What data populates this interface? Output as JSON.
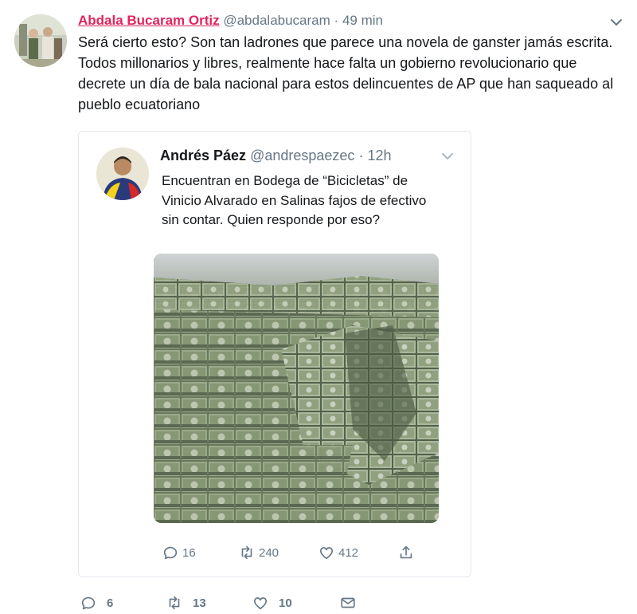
{
  "tweet": {
    "display_name": "Abdala Bucaram Ortiz",
    "handle": "@abdalabucaram",
    "separator": "·",
    "time": "49 min",
    "text": "Será cierto esto? Son tan ladrones que parece una novela de ganster jamás escrita. Todos millonarios y libres, realmente hace falta un gobierno revolucionario que decrete un día de bala nacional para estos delincuentes de AP que han saqueado al pueblo ecuatoriano",
    "actions": {
      "reply_count": "6",
      "retweet_count": "13",
      "like_count": "10"
    }
  },
  "quoted": {
    "display_name": "Andrés Páez",
    "handle": "@andrespaezec",
    "separator": "·",
    "time": "12h",
    "text": "Encuentran en Bodega de “Bicicletas” de Vinicio Alvarado en Salinas fajos de efectivo sin contar. Quien responde por eso?",
    "actions": {
      "reply_count": "16",
      "retweet_count": "240",
      "like_count": "412"
    }
  },
  "icons": {
    "caret": "chevron-down-icon",
    "reply": "reply-icon",
    "retweet": "retweet-icon",
    "like": "heart-icon",
    "share": "share-icon",
    "dm": "envelope-icon"
  },
  "colors": {
    "name_accent": "#e0245e",
    "secondary_text": "#657786",
    "border": "#e1e8ed"
  }
}
